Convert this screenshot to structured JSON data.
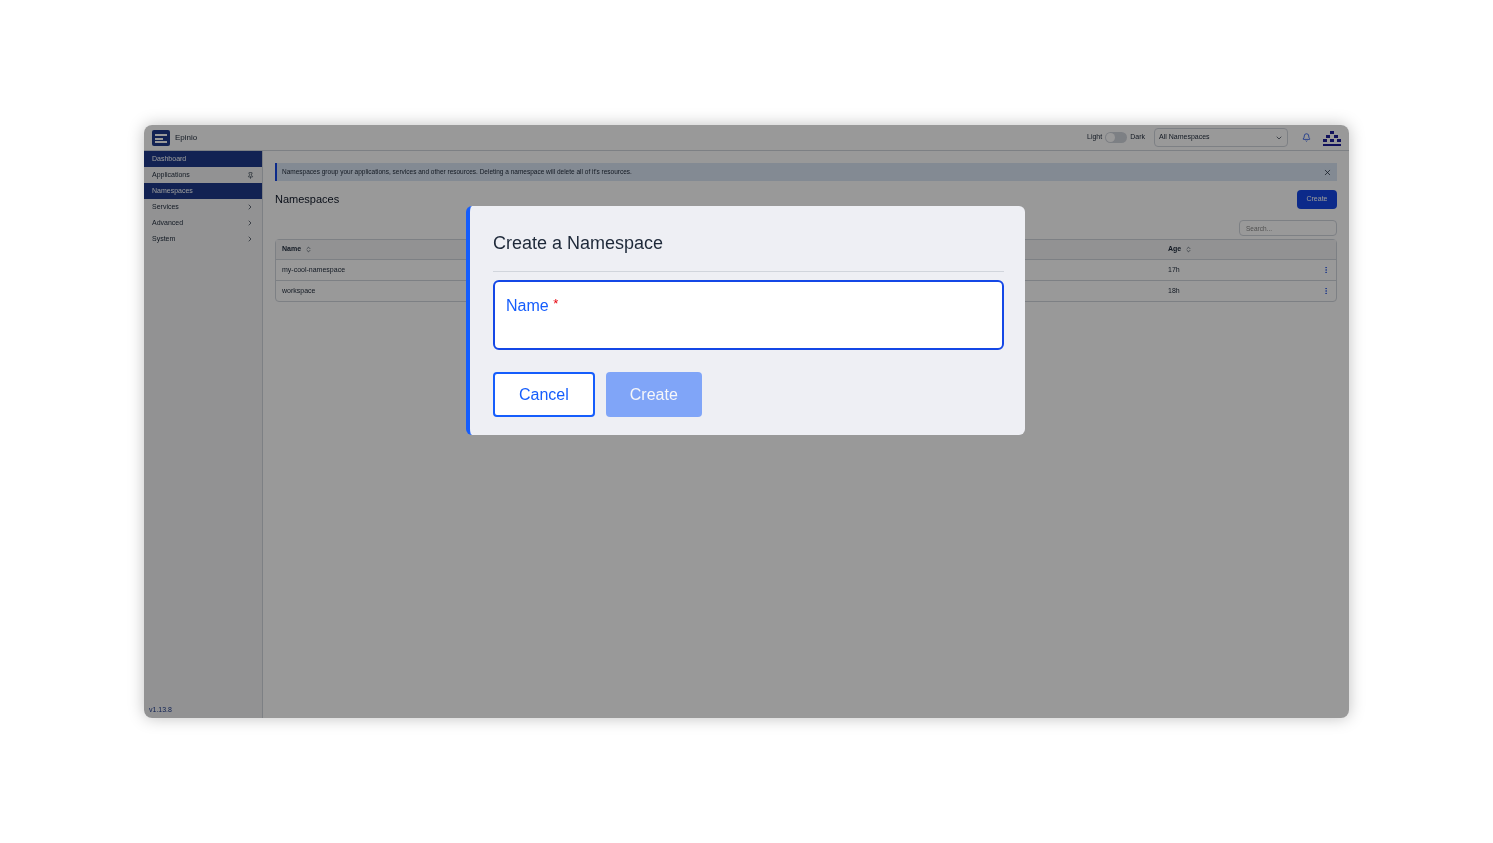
{
  "header": {
    "brand": "Epinio",
    "theme_toggle": {
      "left_label": "Light",
      "right_label": "Dark",
      "on": false
    },
    "namespace_select": {
      "value": "All Namespaces"
    }
  },
  "sidebar": {
    "items": [
      {
        "label": "Dashboard",
        "selected": true,
        "kind": "link"
      },
      {
        "label": "Applications",
        "selected": false,
        "kind": "pinned"
      },
      {
        "label": "Namespaces",
        "selected": true,
        "kind": "link"
      },
      {
        "label": "Services",
        "selected": false,
        "kind": "group"
      },
      {
        "label": "Advanced",
        "selected": false,
        "kind": "group"
      },
      {
        "label": "System",
        "selected": false,
        "kind": "group"
      }
    ],
    "version": "v1.13.8"
  },
  "banner": {
    "text": "Namespaces group your applications, services and other resources. Deleting a namespace will delete all of it's resources."
  },
  "page": {
    "title": "Namespaces",
    "create_button": "Create",
    "search": {
      "placeholder": "Search..."
    }
  },
  "table": {
    "columns": [
      "Name",
      "Age"
    ],
    "rows": [
      {
        "name": "my-cool-namespace",
        "age": "17h"
      },
      {
        "name": "workspace",
        "age": "18h"
      }
    ]
  },
  "dialog": {
    "title": "Create a Namespace",
    "field": {
      "label": "Name",
      "required_mark": "*"
    },
    "buttons": [
      {
        "label": "Cancel",
        "kind": "secondary",
        "disabled": false
      },
      {
        "label": "Create",
        "kind": "primary",
        "disabled": true
      }
    ]
  }
}
